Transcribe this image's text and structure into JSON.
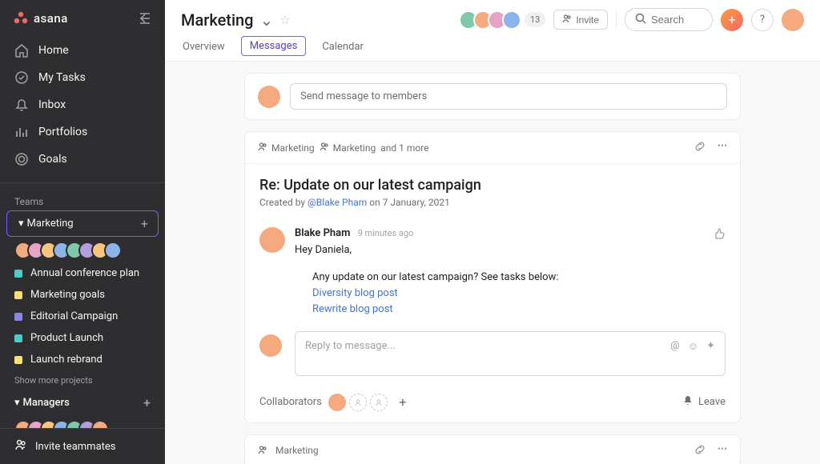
{
  "brand": "asana",
  "sidebar": {
    "nav": [
      {
        "icon": "home",
        "label": "Home"
      },
      {
        "icon": "check-circle",
        "label": "My Tasks"
      },
      {
        "icon": "bell",
        "label": "Inbox"
      },
      {
        "icon": "bars",
        "label": "Portfolios"
      },
      {
        "icon": "target",
        "label": "Goals"
      }
    ],
    "teams_label": "Teams",
    "team1": {
      "name": "Marketing",
      "avatars": [
        "#f5a97f",
        "#e6a3c4",
        "#f8c57c",
        "#8bb5e8",
        "#7fc8a9",
        "#b39ddb",
        "#f8c57c",
        "#8bb5e8"
      ]
    },
    "projects": [
      {
        "color": "#4ecbc4",
        "name": "Annual conference plan"
      },
      {
        "color": "#f8df72",
        "name": "Marketing goals"
      },
      {
        "color": "#8d84e8",
        "name": "Editorial Campaign"
      },
      {
        "color": "#4ecbc4",
        "name": "Product Launch"
      },
      {
        "color": "#f8df72",
        "name": "Launch rebrand"
      }
    ],
    "show_more": "Show more projects",
    "team2": {
      "name": "Managers",
      "avatars": [
        "#f5a97f",
        "#e6a3c4",
        "#f8c57c",
        "#8bb5e8",
        "#7fc8a9",
        "#b39ddb",
        "#f5a97f"
      ]
    },
    "invite": "Invite teammates"
  },
  "header": {
    "title": "Marketing",
    "member_count": "13",
    "invite_label": "Invite",
    "search_placeholder": "Search",
    "avatars": [
      "#7fc8a9",
      "#f5a97f",
      "#e6a3c4",
      "#8bb5e8"
    ],
    "tabs": [
      {
        "label": "Overview",
        "active": false
      },
      {
        "label": "Messages",
        "active": true
      },
      {
        "label": "Calendar",
        "active": false
      }
    ]
  },
  "compose": {
    "placeholder": "Send message to members"
  },
  "thread": {
    "audience1": "Marketing",
    "audience2": "Marketing",
    "audience_more": "and 1 more",
    "title": "Re: Update on our latest campaign",
    "created_prefix": "Created by ",
    "created_by": "@Blake Pham",
    "created_suffix": " on 7 January, 2021",
    "author": "Blake Pham",
    "time": "9 minutes ago",
    "greeting": "Hey Daniela,",
    "body": "Any update on our latest campaign? See tasks below:",
    "link1": "Diversity blog post",
    "link2": "Rewrite blog post",
    "reply_placeholder": "Reply to message...",
    "collaborators_label": "Collaborators",
    "leave_label": "Leave"
  },
  "thread2": {
    "audience": "Marketing"
  }
}
